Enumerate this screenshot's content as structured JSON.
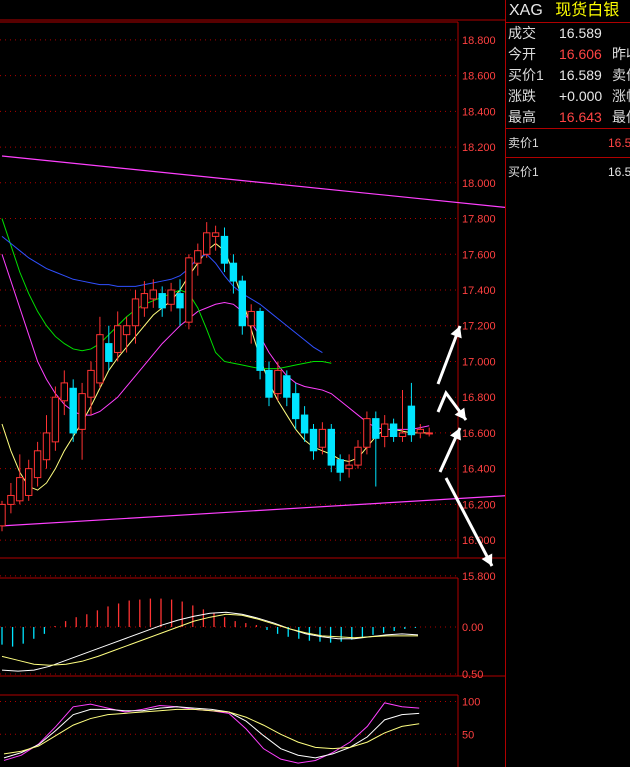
{
  "header": {
    "symbol": "XAG",
    "name": "现货白银"
  },
  "quote": [
    {
      "label": "成交",
      "value": "16.589",
      "color": "#e8e8e8",
      "label2": ""
    },
    {
      "label": "今开",
      "value": "16.606",
      "color": "#ff4444",
      "label2": "昨收"
    },
    {
      "label": "买价1",
      "value": "16.589",
      "color": "#e8e8e8",
      "label2": "卖价"
    },
    {
      "label": "涨跌",
      "value": "+0.000",
      "color": "#e8e8e8",
      "label2": "涨幅"
    },
    {
      "label": "最高",
      "value": "16.643",
      "color": "#ff4444",
      "label2": "最低"
    }
  ],
  "orderbook": [
    {
      "label": "卖价1",
      "value": "16.5",
      "color": "#ff4444"
    },
    {
      "label": "买价1",
      "value": "16.5",
      "color": "#e8e8e8"
    }
  ],
  "colors": {
    "up": "#ff3333",
    "down": "#00e5ff",
    "grid": "#b00000",
    "ma_yellow": "#ffff80",
    "ma_magenta": "#ff40ff",
    "ma_green": "#00e000",
    "ma_blue": "#3050ff",
    "arrow": "#ffffff"
  },
  "chart_data": [
    {
      "type": "candlestick",
      "ylim": [
        15.9,
        18.9
      ],
      "yticks": [
        "18.800",
        "18.600",
        "18.400",
        "18.200",
        "18.000",
        "17.800",
        "17.600",
        "17.400",
        "17.200",
        "17.000",
        "16.800",
        "16.600",
        "16.400",
        "16.200",
        "16.000",
        "15.800"
      ],
      "candles": [
        [
          16.08,
          16.2,
          16.05,
          16.22
        ],
        [
          16.2,
          16.25,
          16.15,
          16.32
        ],
        [
          16.22,
          16.35,
          16.2,
          16.48
        ],
        [
          16.25,
          16.4,
          16.22,
          16.45
        ],
        [
          16.35,
          16.5,
          16.3,
          16.55
        ],
        [
          16.45,
          16.6,
          16.4,
          16.7
        ],
        [
          16.55,
          16.8,
          16.5,
          16.86
        ],
        [
          16.78,
          16.88,
          16.7,
          16.95
        ],
        [
          16.85,
          16.6,
          16.55,
          16.9
        ],
        [
          16.62,
          16.82,
          16.45,
          16.88
        ],
        [
          16.8,
          16.95,
          16.7,
          17.0
        ],
        [
          16.88,
          17.15,
          16.85,
          17.25
        ],
        [
          17.1,
          17.0,
          16.95,
          17.2
        ],
        [
          17.05,
          17.2,
          17.0,
          17.28
        ],
        [
          17.15,
          17.2,
          17.05,
          17.25
        ],
        [
          17.2,
          17.35,
          17.1,
          17.4
        ],
        [
          17.3,
          17.38,
          17.25,
          17.45
        ],
        [
          17.35,
          17.4,
          17.3,
          17.46
        ],
        [
          17.38,
          17.3,
          17.25,
          17.42
        ],
        [
          17.32,
          17.4,
          17.28,
          17.44
        ],
        [
          17.38,
          17.3,
          17.2,
          17.46
        ],
        [
          17.22,
          17.58,
          17.18,
          17.6
        ],
        [
          17.55,
          17.62,
          17.48,
          17.66
        ],
        [
          17.6,
          17.72,
          17.58,
          17.78
        ],
        [
          17.7,
          17.72,
          17.62,
          17.76
        ],
        [
          17.7,
          17.55,
          17.5,
          17.75
        ],
        [
          17.55,
          17.45,
          17.38,
          17.6
        ],
        [
          17.45,
          17.2,
          17.15,
          17.48
        ],
        [
          17.2,
          17.28,
          17.1,
          17.32
        ],
        [
          17.28,
          16.95,
          16.9,
          17.3
        ],
        [
          16.95,
          16.8,
          16.75,
          17.0
        ],
        [
          16.82,
          16.95,
          16.78,
          17.0
        ],
        [
          16.92,
          16.8,
          16.75,
          16.95
        ],
        [
          16.82,
          16.68,
          16.62,
          16.88
        ],
        [
          16.7,
          16.6,
          16.55,
          16.75
        ],
        [
          16.62,
          16.5,
          16.45,
          16.65
        ],
        [
          16.52,
          16.62,
          16.48,
          16.66
        ],
        [
          16.62,
          16.42,
          16.38,
          16.65
        ],
        [
          16.45,
          16.38,
          16.33,
          16.48
        ],
        [
          16.4,
          16.42,
          16.35,
          16.48
        ],
        [
          16.42,
          16.52,
          16.4,
          16.56
        ],
        [
          16.52,
          16.68,
          16.48,
          16.72
        ],
        [
          16.68,
          16.57,
          16.3,
          16.72
        ],
        [
          16.58,
          16.65,
          16.52,
          16.7
        ],
        [
          16.65,
          16.58,
          16.55,
          16.68
        ],
        [
          16.58,
          16.6,
          16.55,
          16.84
        ],
        [
          16.75,
          16.59,
          16.55,
          16.88
        ],
        [
          16.6,
          16.62,
          16.57,
          16.65
        ],
        [
          16.6,
          16.6,
          16.58,
          16.63
        ]
      ],
      "trendlines": [
        {
          "from": [
            0,
            18.15
          ],
          "to": [
            57,
            17.86
          ],
          "color": "#ff40ff"
        },
        {
          "from": [
            0,
            16.08
          ],
          "to": [
            57,
            16.25
          ],
          "color": "#ff40ff"
        }
      ],
      "moving_averages": [
        {
          "color": "#ffff80",
          "values": [
            16.65,
            16.5,
            16.38,
            16.3,
            16.28,
            16.32,
            16.4,
            16.5,
            16.58,
            16.66,
            16.75,
            16.85,
            16.95,
            17.02,
            17.08,
            17.14,
            17.2,
            17.26,
            17.3,
            17.34,
            17.4,
            17.48,
            17.55,
            17.62,
            17.66,
            17.62,
            17.5,
            17.35,
            17.18,
            17.02,
            16.88,
            16.78,
            16.7,
            16.62,
            16.56,
            16.52,
            16.5,
            16.48,
            16.45,
            16.44,
            16.46,
            16.52,
            16.58,
            16.62,
            16.62,
            16.61,
            16.6,
            16.6,
            16.6
          ]
        },
        {
          "color": "#ff40ff",
          "values": [
            17.6,
            17.45,
            17.3,
            17.15,
            17.0,
            16.9,
            16.82,
            16.76,
            16.72,
            16.7,
            16.7,
            16.72,
            16.76,
            16.8,
            16.86,
            16.92,
            16.98,
            17.04,
            17.1,
            17.15,
            17.2,
            17.24,
            17.28,
            17.3,
            17.32,
            17.33,
            17.32,
            17.28,
            17.22,
            17.14,
            17.05,
            16.98,
            16.92,
            16.88,
            16.86,
            16.85,
            16.84,
            16.82,
            16.78,
            16.74,
            16.7,
            16.66,
            16.63,
            16.62,
            16.62,
            16.62,
            16.62,
            16.63,
            16.64
          ]
        },
        {
          "color": "#00e000",
          "values": [
            17.8,
            17.65,
            17.5,
            17.38,
            17.28,
            17.2,
            17.14,
            17.1,
            17.07,
            17.06,
            17.07,
            17.1,
            17.15,
            17.2,
            17.25,
            17.29,
            17.32,
            17.34,
            17.36,
            17.38,
            17.4,
            17.38,
            17.3,
            17.18,
            17.05,
            17.0,
            16.99,
            16.98,
            16.97,
            16.96,
            16.96,
            16.96,
            16.97,
            16.98,
            16.99,
            17.0,
            17.0,
            16.99
          ]
        },
        {
          "color": "#3050ff",
          "values": [
            17.7,
            17.66,
            17.62,
            17.58,
            17.55,
            17.52,
            17.5,
            17.48,
            17.46,
            17.45,
            17.44,
            17.43,
            17.43,
            17.42,
            17.42,
            17.42,
            17.43,
            17.44,
            17.45,
            17.46,
            17.48,
            17.52,
            17.58,
            17.6,
            17.55,
            17.48,
            17.42,
            17.38,
            17.35,
            17.32,
            17.28,
            17.24,
            17.2,
            17.16,
            17.12,
            17.08,
            17.05
          ]
        }
      ]
    },
    {
      "type": "macd",
      "ylim": [
        -0.5,
        0.5
      ],
      "yticks": [
        "0.00",
        "0.50"
      ],
      "histogram": [
        -0.18,
        -0.2,
        -0.17,
        -0.12,
        -0.07,
        0.01,
        0.06,
        0.1,
        0.13,
        0.17,
        0.21,
        0.24,
        0.27,
        0.28,
        0.29,
        0.29,
        0.28,
        0.26,
        0.22,
        0.18,
        0.14,
        0.1,
        0.06,
        0.04,
        0.02,
        -0.03,
        -0.07,
        -0.1,
        -0.12,
        -0.14,
        -0.15,
        -0.16,
        -0.15,
        -0.13,
        -0.11,
        -0.08,
        -0.06,
        -0.04,
        -0.02,
        -0.01
      ],
      "lines": [
        {
          "color": "#ffffff",
          "values": [
            -0.44,
            -0.45,
            -0.44,
            -0.4,
            -0.34,
            -0.28,
            -0.22,
            -0.16,
            -0.1,
            -0.04,
            0.02,
            0.07,
            0.11,
            0.14,
            0.15,
            0.13,
            0.09,
            0.04,
            -0.02,
            -0.07,
            -0.1,
            -0.12,
            -0.12,
            -0.1,
            -0.08,
            -0.07,
            -0.08
          ]
        },
        {
          "color": "#ffff80",
          "values": [
            -0.3,
            -0.34,
            -0.38,
            -0.39,
            -0.38,
            -0.35,
            -0.3,
            -0.24,
            -0.18,
            -0.12,
            -0.06,
            0.0,
            0.06,
            0.1,
            0.13,
            0.12,
            0.08,
            0.03,
            -0.02,
            -0.06,
            -0.09,
            -0.1,
            -0.11,
            -0.1,
            -0.09,
            -0.09,
            -0.09
          ]
        }
      ]
    },
    {
      "type": "kdj",
      "ylim": [
        0,
        110
      ],
      "yticks": [
        "100",
        "50"
      ],
      "lines": [
        {
          "color": "#ff40ff",
          "values": [
            10,
            18,
            35,
            62,
            92,
            96,
            90,
            84,
            88,
            94,
            92,
            88,
            86,
            82,
            58,
            28,
            12,
            6,
            10,
            22,
            38,
            62,
            98,
            92,
            90
          ]
        },
        {
          "color": "#ffffff",
          "values": [
            14,
            22,
            34,
            56,
            80,
            88,
            88,
            86,
            86,
            90,
            92,
            90,
            88,
            84,
            70,
            48,
            28,
            18,
            14,
            20,
            30,
            46,
            72,
            80,
            82
          ]
        },
        {
          "color": "#ffff80",
          "values": [
            20,
            24,
            32,
            48,
            64,
            74,
            80,
            82,
            84,
            86,
            88,
            88,
            86,
            84,
            76,
            64,
            50,
            38,
            30,
            28,
            30,
            38,
            52,
            62,
            66
          ]
        }
      ]
    }
  ]
}
